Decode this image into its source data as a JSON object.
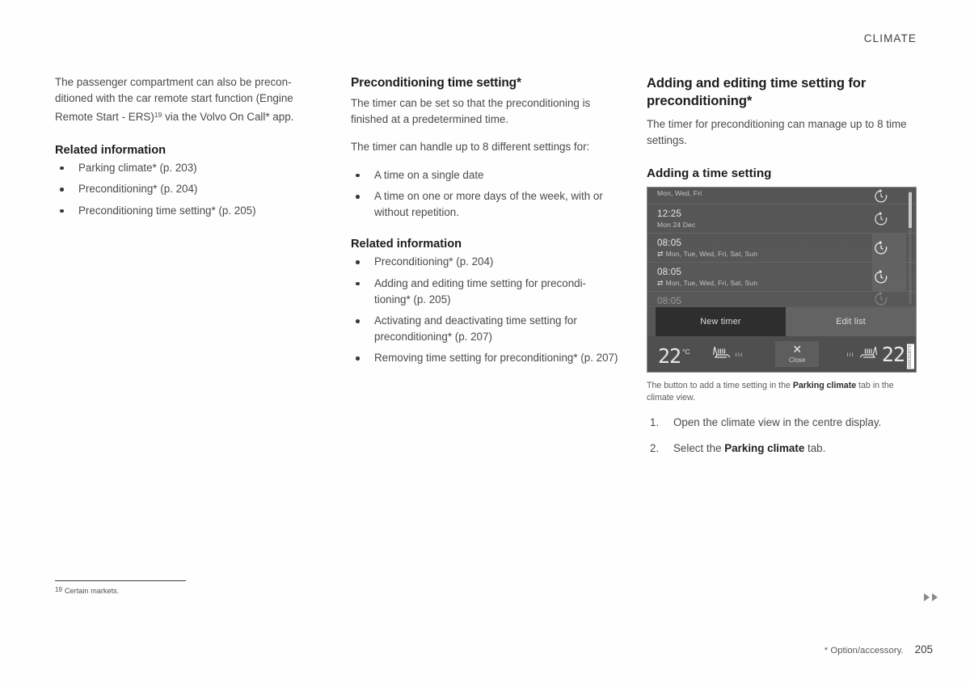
{
  "header": {
    "section_title": "CLIMATE"
  },
  "left_column": {
    "intro_paragraph_part1": "The passenger compartment can also be precon-ditioned with the car remote start function (Engine Remote Start - ERS)",
    "footnote_ref": "19",
    "intro_paragraph_part2": " via the Volvo On Call* app.",
    "related_heading": "Related information",
    "related_links": [
      "Parking climate* (p. 203)",
      "Preconditioning* (p. 204)",
      "Preconditioning time setting* (p. 205)"
    ]
  },
  "middle_column": {
    "heading": "Preconditioning time setting*",
    "paragraph_1": "The timer can be set so that the preconditioning is finished at a predetermined time.",
    "paragraph_2": "The timer can handle up to 8 different settings for:",
    "bullets": [
      "A time on a single date",
      "A time on one or more days of the week, with or without repetition."
    ],
    "related_heading": "Related information",
    "related_links": [
      "Preconditioning* (p. 204)",
      "Adding and editing time setting for precondi-tioning* (p. 205)",
      "Activating and deactivating time setting for preconditioning* (p. 207)",
      "Removing time setting for preconditioning* (p. 207)"
    ]
  },
  "right_column": {
    "heading": "Adding and editing time setting for preconditioning*",
    "paragraph_1": "The timer for preconditioning can manage up to 8 time settings.",
    "subheading": "Adding a time setting",
    "figure": {
      "timer_rows": [
        {
          "time": "",
          "days": "Mon, Wed, Fri",
          "repeat": false,
          "partial": "top",
          "selected": false
        },
        {
          "time": "12:25",
          "days": "Mon 24 Dec",
          "repeat": false,
          "partial": "",
          "selected": false
        },
        {
          "time": "08:05",
          "days": "Mon, Tue, Wed, Fri, Sat, Sun",
          "repeat": true,
          "partial": "",
          "selected": true
        },
        {
          "time": "08:05",
          "days": "Mon, Tue, Wed, Fri, Sat, Sun",
          "repeat": true,
          "partial": "",
          "selected": true
        },
        {
          "time": "08:05",
          "days": "",
          "repeat": false,
          "partial": "bottom",
          "selected": false
        }
      ],
      "buttons": {
        "new_timer": "New timer",
        "edit_list": "Edit list"
      },
      "climate_bar": {
        "temp_left": "22",
        "temp_left_unit": "°C",
        "temp_right": "22",
        "close_label": "Close",
        "close_symbol": "✕",
        "seat_level_bars": "ııı"
      },
      "image_id": "G0031873"
    },
    "caption_part1": "The button to add a time setting in the ",
    "caption_bold": "Parking climate",
    "caption_part2": " tab in the climate view.",
    "steps": [
      {
        "part1": "Open the climate view in the centre display.",
        "bold": "",
        "part2": ""
      },
      {
        "part1": "Select the ",
        "bold": "Parking climate",
        "part2": " tab."
      }
    ]
  },
  "footnote": {
    "marker": "19",
    "text": "Certain markets."
  },
  "footer": {
    "option_note": "* Option/accessory.",
    "page_number": "205"
  }
}
